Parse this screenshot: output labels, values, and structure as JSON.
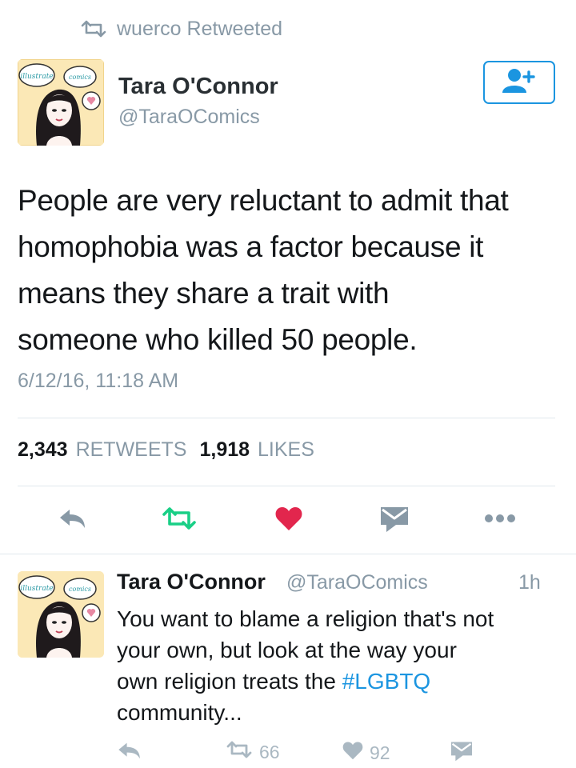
{
  "retweet_context": {
    "label": "wuerco Retweeted"
  },
  "tweet": {
    "author_name": "Tara O'Connor",
    "author_handle": "@TaraOComics",
    "text_lines": [
      "People are very reluctant to admit that",
      "homophobia was a factor because it",
      "means they share a trait with",
      "someone who killed 50 people."
    ],
    "timestamp": "6/12/16, 11:18 AM",
    "retweets_count": "2,343",
    "retweets_label": "RETWEETS",
    "likes_count": "1,918",
    "likes_label": "LIKES"
  },
  "reply": {
    "author_name": "Tara O'Connor",
    "author_handle": "@TaraOComics",
    "time": "1h",
    "text_lines": [
      "You want to blame a religion that's not",
      "your own, but look at the way your",
      "own religion treats the"
    ],
    "hashtag": "#LGBTQ",
    "text_last_line": "community...",
    "retweet_count": "66",
    "like_count": "92"
  },
  "avatar": {
    "bubble_left_text": "illustrate",
    "bubble_right_text": "comics"
  },
  "colors": {
    "accent_blue": "#1b95e0",
    "retweet_green": "#19cf86",
    "like_red": "#e2264d",
    "muted_gray": "#8899a6",
    "icon_gray": "#aab8c2"
  },
  "icons": {
    "retweet_context": "retweet-icon",
    "follow": "add-user-icon",
    "reply": "reply-icon",
    "retweet": "retweet-icon",
    "like": "heart-icon",
    "message": "envelope-icon",
    "more": "more-dots-icon"
  }
}
